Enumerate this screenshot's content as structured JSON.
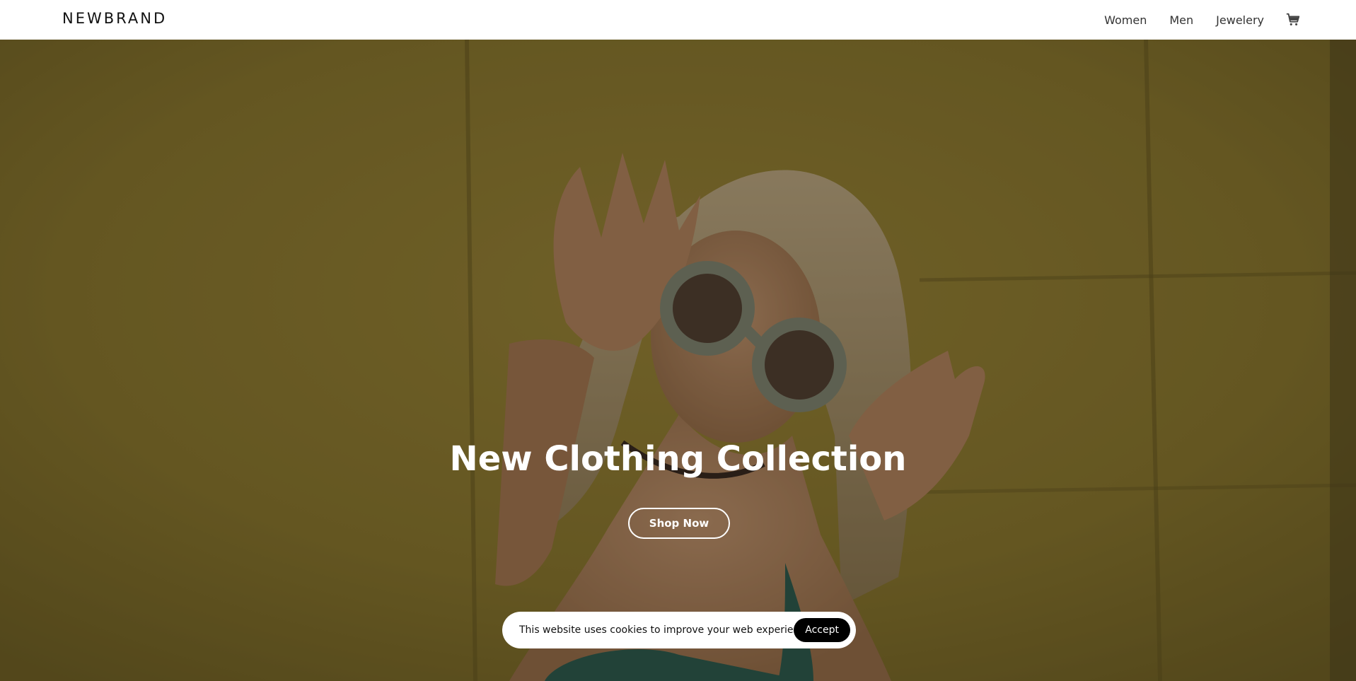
{
  "header": {
    "brand": "NEWBRAND",
    "nav": [
      {
        "label": "Women"
      },
      {
        "label": "Men"
      },
      {
        "label": "Jewelery"
      }
    ],
    "cart_icon": "shopping-cart-icon"
  },
  "hero": {
    "title": "New Clothing Collection",
    "cta_label": "Shop Now"
  },
  "cookie_banner": {
    "message": "This website uses cookies to improve your web experience.",
    "accept_label": "Accept"
  },
  "colors": {
    "header_bg": "#ffffff",
    "hero_tint": "#7a6a2c",
    "cookie_button_bg": "#000000",
    "text_on_hero": "#ffffff"
  }
}
